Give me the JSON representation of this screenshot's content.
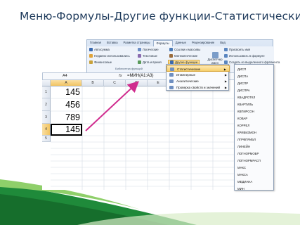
{
  "slide": {
    "title": "Меню-Формулы-Другие функции-Статистические"
  },
  "ribbon": {
    "tabs": [
      "Главная",
      "Вставка",
      "Разметка страницы",
      "Формулы",
      "Данные",
      "Рецензирование",
      "Вид"
    ],
    "active_tab": "Формулы",
    "buttons": {
      "autosum": "Автосумма",
      "recent": "Недавно использовались",
      "financial": "Финансовые",
      "logical": "Логические",
      "text": "Текстовые",
      "datetime": "Дата и время",
      "lookup": "Ссылки и массивы",
      "math": "Математические",
      "more": "Другие функции",
      "name_manager": "Диспетчер имен",
      "assign_name": "Присвоить имя",
      "use_in_formula": "Использовать в формуле",
      "create_from_selection": "Создать из выделенного фрагмента"
    },
    "group_label": "Библиотека функций"
  },
  "formula_bar": {
    "name": "A4",
    "fx": "fx",
    "formula": "=МИН(A1:A3)"
  },
  "grid": {
    "columns": [
      "A",
      "B",
      "C",
      "D",
      "E"
    ],
    "rows": [
      "1",
      "2",
      "3",
      "4",
      "5"
    ],
    "values": [
      "145",
      "456",
      "789",
      "145"
    ]
  },
  "more_menu": {
    "items": [
      {
        "label": "Статистические",
        "highlighted": true
      },
      {
        "label": "Инженерные",
        "highlighted": false
      },
      {
        "label": "Аналитические",
        "highlighted": false
      },
      {
        "label": "Проверка свойств и значений",
        "highlighted": false
      }
    ]
  },
  "stat_functions": [
    "ДИСП",
    "ДИСПА",
    "ДИСПР",
    "ДИСПРА",
    "КВАДРОТКЛ",
    "КВАРТИЛЬ",
    "КВПИРСОН",
    "КОВАР",
    "КОРРЕЛ",
    "КРИВИЗМОН",
    "ЛГРФПРИБЛ",
    "ЛИНЕЙН",
    "ЛОГНОРМОБР",
    "ЛОГНОРМРАСП",
    "МАКС",
    "МАКСА",
    "МЕДИАНА",
    "МИН"
  ]
}
